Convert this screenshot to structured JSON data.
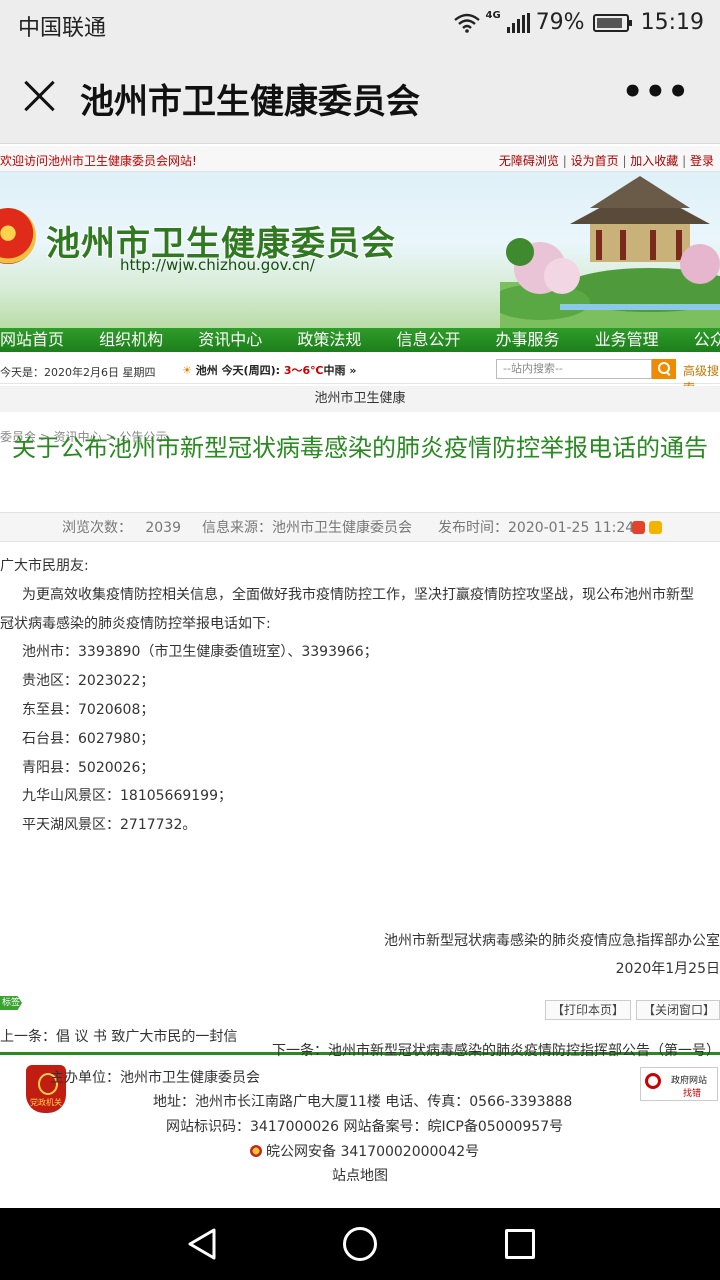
{
  "status_bar": {
    "carrier": "中国联通",
    "network": "4G",
    "battery": "79%",
    "time": "15:19"
  },
  "title_bar": {
    "title": "池州市卫生健康委员会",
    "more": "•••"
  },
  "top_strip": {
    "welcome": "欢迎访问池州市卫生健康委员会网站!",
    "links": [
      "无障碍浏览",
      "设为首页",
      "加入收藏",
      "登录"
    ]
  },
  "banner": {
    "title": "池州市卫生健康委员会",
    "url": "http://wjw.chizhou.gov.cn/"
  },
  "nav": {
    "items": [
      "网站首页",
      "组织机构",
      "资讯中心",
      "政策法规",
      "信息公开",
      "办事服务",
      "业务管理",
      "公众参与"
    ]
  },
  "info_row": {
    "date": "今天是：2020年2月6日 星期四",
    "weather_city": "池州",
    "weather_day": "今天(周四):",
    "weather_temp": "3～6℃",
    "weather_desc": "中雨",
    "search_placeholder": "--站内搜索--",
    "advanced": "高级搜索"
  },
  "subhead": "池州市卫生健康",
  "breadcrumb": "委员会 > 资讯中心 > 公告公示",
  "article": {
    "title": "关于公布池州市新型冠状病毒感染的肺炎疫情防控举报电话的通告",
    "meta_views_label": "浏览次数：",
    "meta_views": "2039",
    "meta_source_label": "信息来源：",
    "meta_source": "池州市卫生健康委员会",
    "meta_date_label": "发布时间：",
    "meta_date": "2020-01-25 11:24",
    "greeting": "广大市民朋友:",
    "intro_1": "为更高效收集疫情防控相关信息，全面做好我市疫情防控工作，坚决打赢疫情防控攻坚战，现公布池州市新型",
    "intro_2": "冠状病毒感染的肺炎疫情防控举报电话如下:",
    "phones": [
      "池州市：3393890（市卫生健康委值班室）、3393966；",
      "贵池区：2023022；",
      "东至县：7020608；",
      "石台县：6027980；",
      "青阳县：5020026；",
      "九华山风景区：18105669199；",
      "平天湖风景区：2717732。"
    ],
    "signature": "池州市新型冠状病毒感染的肺炎疫情应急指挥部办公室",
    "sign_date": "2020年1月25日"
  },
  "actions": {
    "tag": "标签",
    "print": "【打印本页】",
    "close": "【关闭窗口】"
  },
  "pager": {
    "prev": "上一条：倡 议 书 致广大市民的一封信",
    "next": "下一条：池州市新型冠状病毒感染的肺炎疫情防控指挥部公告（第一号）"
  },
  "footer": {
    "party_badge": "党政机关",
    "host": "主办单位：池州市卫生健康委员会",
    "address": "地址：池州市长江南路广电大厦11楼 电话、传真：0566-3393888",
    "ids": "网站标识码：3417000026 网站备案号：皖ICP备05000957号",
    "police": "皖公网安备 34170002000042号",
    "sitemap": "站点地图",
    "gov_error_1": "政府网站",
    "gov_error_2": "找错"
  }
}
